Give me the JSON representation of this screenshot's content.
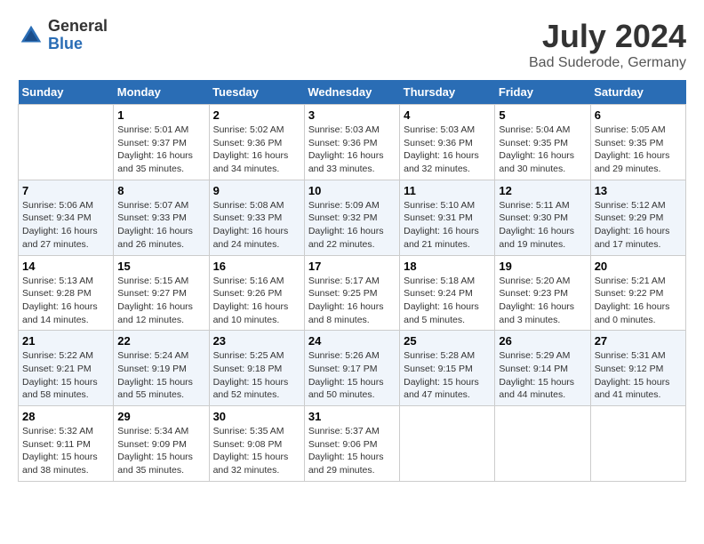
{
  "logo": {
    "general": "General",
    "blue": "Blue"
  },
  "title": {
    "month_year": "July 2024",
    "location": "Bad Suderode, Germany"
  },
  "weekdays": [
    "Sunday",
    "Monday",
    "Tuesday",
    "Wednesday",
    "Thursday",
    "Friday",
    "Saturday"
  ],
  "weeks": [
    [
      {
        "day": "",
        "detail": ""
      },
      {
        "day": "1",
        "detail": "Sunrise: 5:01 AM\nSunset: 9:37 PM\nDaylight: 16 hours\nand 35 minutes."
      },
      {
        "day": "2",
        "detail": "Sunrise: 5:02 AM\nSunset: 9:36 PM\nDaylight: 16 hours\nand 34 minutes."
      },
      {
        "day": "3",
        "detail": "Sunrise: 5:03 AM\nSunset: 9:36 PM\nDaylight: 16 hours\nand 33 minutes."
      },
      {
        "day": "4",
        "detail": "Sunrise: 5:03 AM\nSunset: 9:36 PM\nDaylight: 16 hours\nand 32 minutes."
      },
      {
        "day": "5",
        "detail": "Sunrise: 5:04 AM\nSunset: 9:35 PM\nDaylight: 16 hours\nand 30 minutes."
      },
      {
        "day": "6",
        "detail": "Sunrise: 5:05 AM\nSunset: 9:35 PM\nDaylight: 16 hours\nand 29 minutes."
      }
    ],
    [
      {
        "day": "7",
        "detail": "Sunrise: 5:06 AM\nSunset: 9:34 PM\nDaylight: 16 hours\nand 27 minutes."
      },
      {
        "day": "8",
        "detail": "Sunrise: 5:07 AM\nSunset: 9:33 PM\nDaylight: 16 hours\nand 26 minutes."
      },
      {
        "day": "9",
        "detail": "Sunrise: 5:08 AM\nSunset: 9:33 PM\nDaylight: 16 hours\nand 24 minutes."
      },
      {
        "day": "10",
        "detail": "Sunrise: 5:09 AM\nSunset: 9:32 PM\nDaylight: 16 hours\nand 22 minutes."
      },
      {
        "day": "11",
        "detail": "Sunrise: 5:10 AM\nSunset: 9:31 PM\nDaylight: 16 hours\nand 21 minutes."
      },
      {
        "day": "12",
        "detail": "Sunrise: 5:11 AM\nSunset: 9:30 PM\nDaylight: 16 hours\nand 19 minutes."
      },
      {
        "day": "13",
        "detail": "Sunrise: 5:12 AM\nSunset: 9:29 PM\nDaylight: 16 hours\nand 17 minutes."
      }
    ],
    [
      {
        "day": "14",
        "detail": "Sunrise: 5:13 AM\nSunset: 9:28 PM\nDaylight: 16 hours\nand 14 minutes."
      },
      {
        "day": "15",
        "detail": "Sunrise: 5:15 AM\nSunset: 9:27 PM\nDaylight: 16 hours\nand 12 minutes."
      },
      {
        "day": "16",
        "detail": "Sunrise: 5:16 AM\nSunset: 9:26 PM\nDaylight: 16 hours\nand 10 minutes."
      },
      {
        "day": "17",
        "detail": "Sunrise: 5:17 AM\nSunset: 9:25 PM\nDaylight: 16 hours\nand 8 minutes."
      },
      {
        "day": "18",
        "detail": "Sunrise: 5:18 AM\nSunset: 9:24 PM\nDaylight: 16 hours\nand 5 minutes."
      },
      {
        "day": "19",
        "detail": "Sunrise: 5:20 AM\nSunset: 9:23 PM\nDaylight: 16 hours\nand 3 minutes."
      },
      {
        "day": "20",
        "detail": "Sunrise: 5:21 AM\nSunset: 9:22 PM\nDaylight: 16 hours\nand 0 minutes."
      }
    ],
    [
      {
        "day": "21",
        "detail": "Sunrise: 5:22 AM\nSunset: 9:21 PM\nDaylight: 15 hours\nand 58 minutes."
      },
      {
        "day": "22",
        "detail": "Sunrise: 5:24 AM\nSunset: 9:19 PM\nDaylight: 15 hours\nand 55 minutes."
      },
      {
        "day": "23",
        "detail": "Sunrise: 5:25 AM\nSunset: 9:18 PM\nDaylight: 15 hours\nand 52 minutes."
      },
      {
        "day": "24",
        "detail": "Sunrise: 5:26 AM\nSunset: 9:17 PM\nDaylight: 15 hours\nand 50 minutes."
      },
      {
        "day": "25",
        "detail": "Sunrise: 5:28 AM\nSunset: 9:15 PM\nDaylight: 15 hours\nand 47 minutes."
      },
      {
        "day": "26",
        "detail": "Sunrise: 5:29 AM\nSunset: 9:14 PM\nDaylight: 15 hours\nand 44 minutes."
      },
      {
        "day": "27",
        "detail": "Sunrise: 5:31 AM\nSunset: 9:12 PM\nDaylight: 15 hours\nand 41 minutes."
      }
    ],
    [
      {
        "day": "28",
        "detail": "Sunrise: 5:32 AM\nSunset: 9:11 PM\nDaylight: 15 hours\nand 38 minutes."
      },
      {
        "day": "29",
        "detail": "Sunrise: 5:34 AM\nSunset: 9:09 PM\nDaylight: 15 hours\nand 35 minutes."
      },
      {
        "day": "30",
        "detail": "Sunrise: 5:35 AM\nSunset: 9:08 PM\nDaylight: 15 hours\nand 32 minutes."
      },
      {
        "day": "31",
        "detail": "Sunrise: 5:37 AM\nSunset: 9:06 PM\nDaylight: 15 hours\nand 29 minutes."
      },
      {
        "day": "",
        "detail": ""
      },
      {
        "day": "",
        "detail": ""
      },
      {
        "day": "",
        "detail": ""
      }
    ]
  ]
}
